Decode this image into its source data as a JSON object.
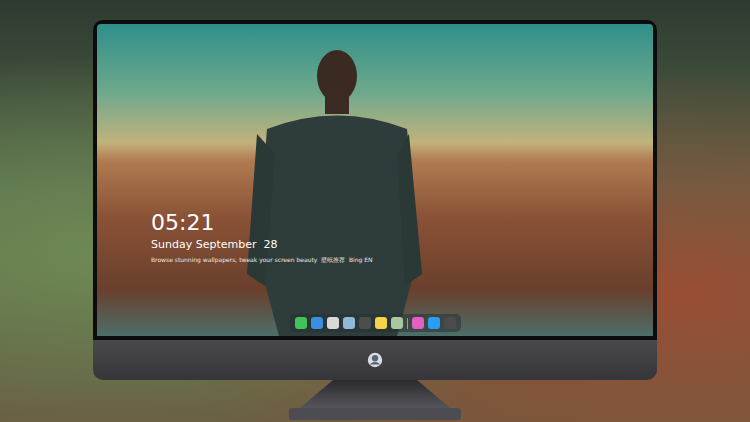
{
  "lock_screen": {
    "time": "05:21",
    "date": "Sunday September  28",
    "caption": "Browse stunning wallpapers, tweak your screen beauty  壁纸推荐  Bing EN"
  },
  "dock": {
    "items": [
      {
        "kind": "app",
        "color": "#3fc35a"
      },
      {
        "kind": "app",
        "color": "#3a8fe0"
      },
      {
        "kind": "app",
        "color": "#d9d9d9"
      },
      {
        "kind": "app",
        "color": "#8fb9d6"
      },
      {
        "kind": "app",
        "color": "#4d4d4d"
      },
      {
        "kind": "app",
        "color": "#f5d34a"
      },
      {
        "kind": "app",
        "color": "#a9c7a0"
      },
      {
        "kind": "separator",
        "color": "#9a9a9a"
      },
      {
        "kind": "app",
        "color": "#e35fc2"
      },
      {
        "kind": "app",
        "color": "#2a9df4"
      },
      {
        "kind": "app",
        "color": "#4a4a4f"
      }
    ]
  }
}
